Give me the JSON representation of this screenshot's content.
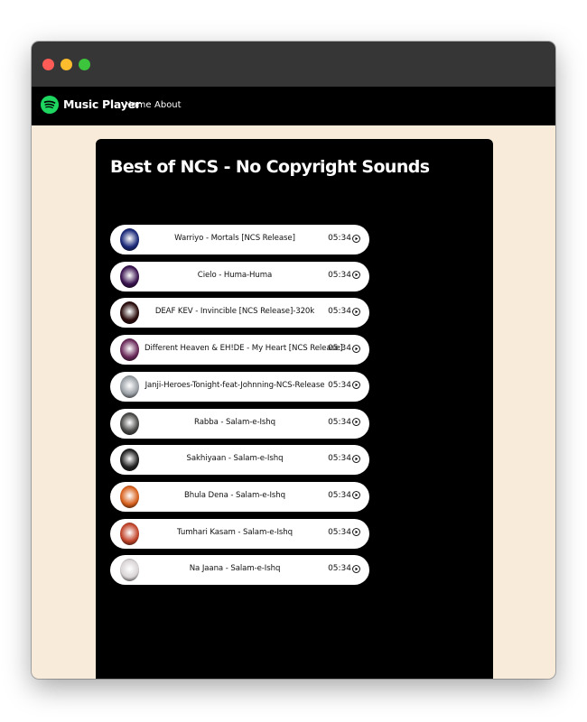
{
  "window": {
    "controls": [
      "close",
      "minimize",
      "maximize"
    ]
  },
  "navbar": {
    "brand": "Music Player",
    "logo_icon": "spotify-logo-icon",
    "links": [
      {
        "label": "Home"
      },
      {
        "label": "About"
      }
    ]
  },
  "playlist": {
    "title": "Best of NCS - No Copyright Sounds",
    "songs": [
      {
        "name": "Warriyo - Mortals [NCS Release]",
        "duration": "05:34",
        "cover_color": "#1b2a7a"
      },
      {
        "name": "Cielo - Huma-Huma",
        "duration": "05:34",
        "cover_color": "#3a1450"
      },
      {
        "name": "DEAF KEV - Invincible [NCS Release]-320k",
        "duration": "05:34",
        "cover_color": "#2b0c0c"
      },
      {
        "name": "Different Heaven & EH!DE - My Heart [NCS Release]",
        "duration": "05:34",
        "cover_color": "#6a2a5a"
      },
      {
        "name": "Janji-Heroes-Tonight-feat-Johnning-NCS-Release",
        "duration": "05:34",
        "cover_color": "#9aa0a6"
      },
      {
        "name": "Rabba - Salam-e-Ishq",
        "duration": "05:34",
        "cover_color": "#4a4a48"
      },
      {
        "name": "Sakhiyaan - Salam-e-Ishq",
        "duration": "05:34",
        "cover_color": "#222222"
      },
      {
        "name": "Bhula Dena - Salam-e-Ishq",
        "duration": "05:34",
        "cover_color": "#d8621e"
      },
      {
        "name": "Tumhari Kasam - Salam-e-Ishq",
        "duration": "05:34",
        "cover_color": "#c2452b"
      },
      {
        "name": "Na Jaana - Salam-e-Ishq",
        "duration": "05:34",
        "cover_color": "#d9d4d6"
      }
    ]
  },
  "colors": {
    "page_background": "#f9ebd9",
    "navbar": "#000000",
    "card": "#000000",
    "song_pill": "#ffffff",
    "brand_green": "#1ed760"
  }
}
